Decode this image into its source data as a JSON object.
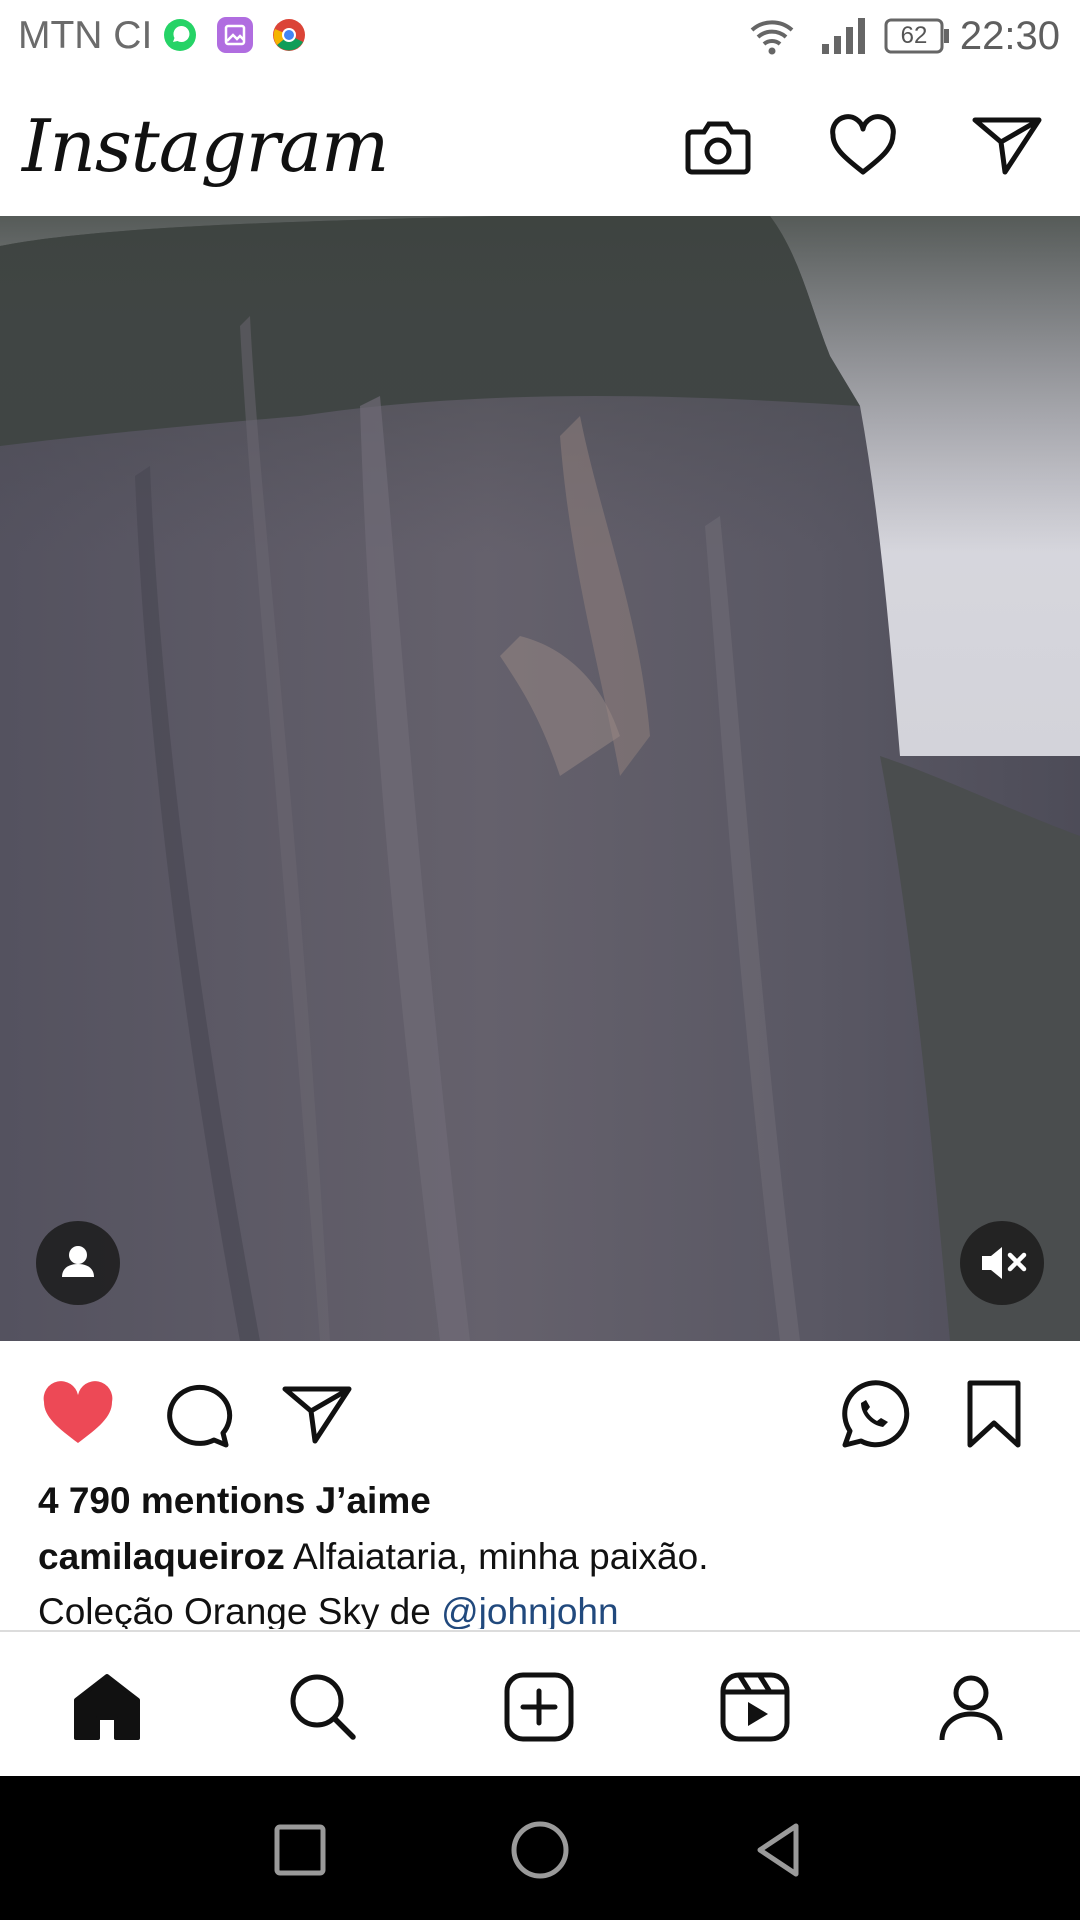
{
  "status_bar": {
    "carrier": "MTN CI",
    "battery": "62",
    "time": "22:30",
    "app_icons": [
      "whatsapp-icon",
      "gallery-icon",
      "chrome-icon"
    ]
  },
  "header": {
    "logo": "Instagram",
    "icons": [
      "camera-icon",
      "heart-icon",
      "direct-send-icon"
    ]
  },
  "post": {
    "likes": "4 790 mentions J’aime",
    "username": "camilaqueiroz",
    "caption": "Alfaiataria, minha paixão.",
    "caption_line2": "Coleção Orange Sky de ",
    "mention": "@johnjohn",
    "liked": true,
    "like_color": "#ed4956",
    "mention_color": "#21497d"
  },
  "bottom_nav": [
    "home-icon",
    "search-icon",
    "new-post-icon",
    "reels-icon",
    "profile-icon"
  ],
  "system_nav": [
    "recents-icon",
    "home-circle-icon",
    "back-icon"
  ]
}
